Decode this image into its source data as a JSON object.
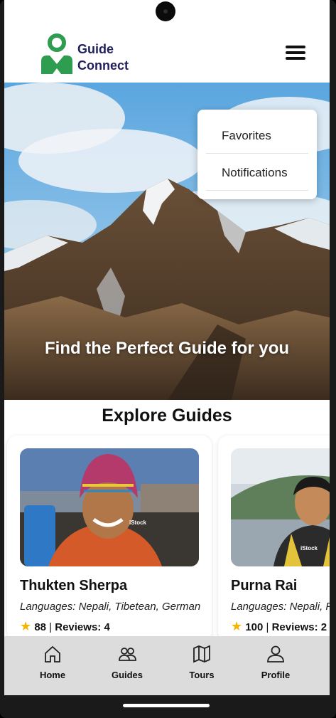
{
  "brand": {
    "line1": "Guide",
    "line2": "Connect"
  },
  "menu": {
    "items": [
      "Favorites",
      "Notifications"
    ]
  },
  "hero": {
    "title": "Find the Perfect Guide for you"
  },
  "section": {
    "title": "Explore Guides"
  },
  "guides": [
    {
      "name": "Thukten Sherpa",
      "languages": "Languages: Nepali, Tibetean, German",
      "rating": "88",
      "separator": "|",
      "reviews": "Reviews: 4",
      "watermark": "iStock"
    },
    {
      "name": "Purna Rai",
      "languages": "Languages: Nepali, F",
      "rating": "100",
      "separator": "|",
      "reviews": "Reviews: 2",
      "watermark": "iStock"
    }
  ],
  "tabs": [
    "Home",
    "Guides",
    "Tours",
    "Profile"
  ],
  "colors": {
    "brand_green": "#2e9d4f",
    "brand_navy": "#1f1f5e",
    "tabbar_bg": "#dcdcdc",
    "star": "#f4b400"
  }
}
